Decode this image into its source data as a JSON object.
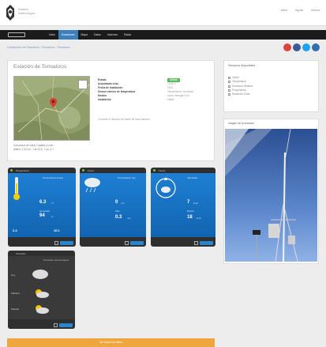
{
  "header": {
    "logo_text_line1": "Estación",
    "logo_text_line2": "Meteorológica",
    "links": [
      "Inicio",
      "Ayuda",
      "Idioma"
    ]
  },
  "nav": {
    "items": [
      {
        "label": "Inicio",
        "active": false
      },
      {
        "label": "Estaciones",
        "active": true
      },
      {
        "label": "Mapa",
        "active": false
      },
      {
        "label": "Datos",
        "active": false
      },
      {
        "label": "Informes",
        "active": false
      },
      {
        "label": "Radar",
        "active": false
      }
    ]
  },
  "breadcrumb": "Localización de Estaciones  ›  Tornadizos  ›  Tornadizos",
  "social": {
    "colors": [
      "#d9443b",
      "#3b5998",
      "#1da1f2",
      "#2f6fb0"
    ]
  },
  "station": {
    "title": "Estación de Tornadizos",
    "map_caption_line1": "Tornadizos de Ávila, Castilla y León",
    "map_caption_line2": "Altitud: 1.313 m · Lat 40.6 · Lon -4.7",
    "details": [
      {
        "label": "Estado",
        "value": "Activa",
        "badge": true
      },
      {
        "label": "Actualizado a las",
        "value": "12:00 h"
      },
      {
        "label": "Fecha de instalación",
        "value": "2010"
      },
      {
        "label": "Sensor externo de temperatura",
        "value": "Temperatura, humedad"
      },
      {
        "label": "Modelo",
        "value": "Davis Vantage Pro2"
      },
      {
        "label": "Instalación",
        "value": "Mástil"
      }
    ],
    "note": "Consulte el histórico de datos de esta estación"
  },
  "right_panel": {
    "title": "Sensores disponibles",
    "items": [
      "Viento",
      "Temperatura",
      "Humedad Relativa",
      "Precipitación",
      "Radiación Solar"
    ]
  },
  "photo_panel": {
    "title": "Imagen de la estación"
  },
  "widgets": {
    "temperature": {
      "title": "Temperatura",
      "value": "6.3",
      "unit": "°C",
      "value2": "94",
      "unit2": "%",
      "label": "Temperatura actual",
      "label2": "Humedad",
      "min": "2.4",
      "max": "10.1"
    },
    "rain": {
      "title": "Lluvia",
      "value": "0",
      "unit": "mm",
      "value2": "0.3",
      "unit2": "mm",
      "label": "Precipitación hoy",
      "label2": "Mes"
    },
    "wind": {
      "title": "Viento",
      "value": "7",
      "unit": "km/h",
      "value2": "18",
      "unit2": "km/h",
      "label": "Velocidad",
      "label2": "Racha"
    },
    "forecast": {
      "title": "Previsión",
      "label": "Previsión meteorológica",
      "rows": [
        "Hoy",
        "Mañana",
        "Pasado"
      ]
    }
  },
  "bottom_button": "Ver todos los datos"
}
